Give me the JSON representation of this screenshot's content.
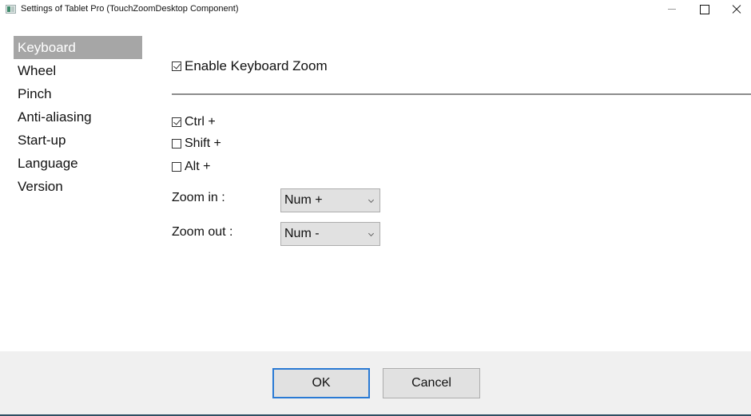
{
  "window": {
    "title": "Settings of Tablet Pro (TouchZoomDesktop Component)",
    "icon": "app-icon",
    "controls": {
      "minimize": "minimize-icon",
      "maximize": "maximize-icon",
      "close": "close-icon"
    }
  },
  "sidebar": {
    "items": [
      {
        "label": "Keyboard",
        "active": true
      },
      {
        "label": "Wheel",
        "active": false
      },
      {
        "label": "Pinch",
        "active": false
      },
      {
        "label": "Anti-aliasing",
        "active": false
      },
      {
        "label": "Start-up",
        "active": false
      },
      {
        "label": "Language",
        "active": false
      },
      {
        "label": "Version",
        "active": false
      }
    ]
  },
  "keyboard": {
    "enable": {
      "label": "Enable Keyboard Zoom",
      "checked": true
    },
    "modifiers": [
      {
        "label": "Ctrl +",
        "checked": true
      },
      {
        "label": "Shift +",
        "checked": false
      },
      {
        "label": "Alt +",
        "checked": false
      }
    ],
    "zoom_in": {
      "label": "Zoom in :",
      "value": "Num +"
    },
    "zoom_out": {
      "label": "Zoom out :",
      "value": "Num -"
    }
  },
  "footer": {
    "ok_label": "OK",
    "cancel_label": "Cancel"
  },
  "colors": {
    "active_nav_bg": "#a6a6a6",
    "ok_focus_border": "#2a7ad4",
    "footer_bg": "#f0f0f0"
  }
}
